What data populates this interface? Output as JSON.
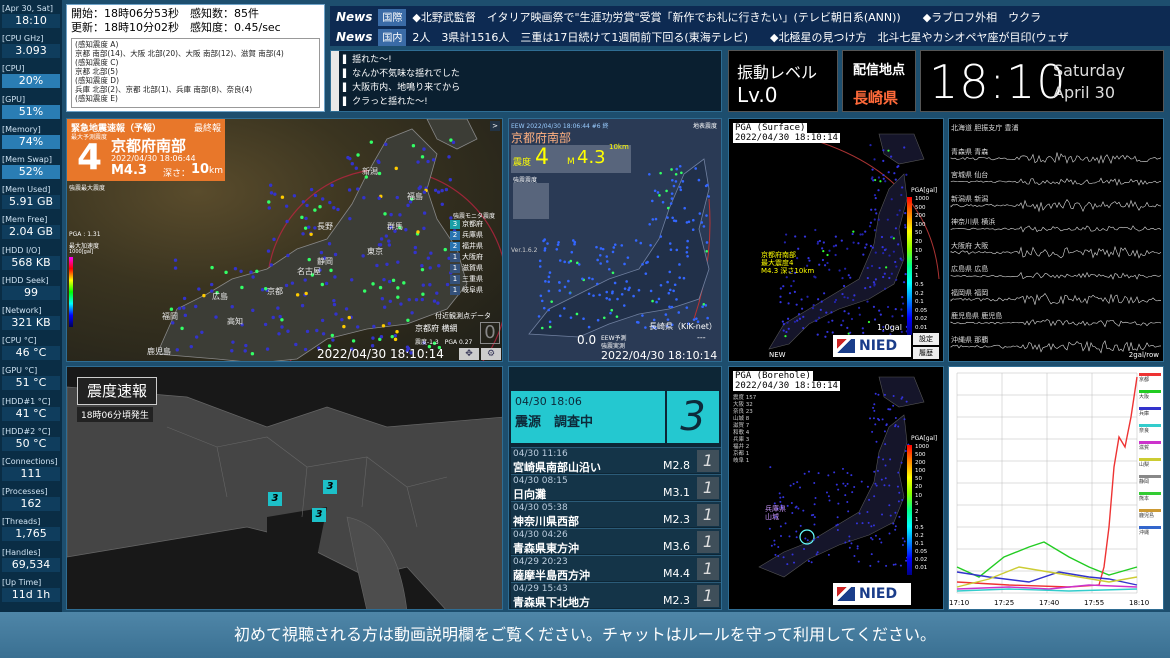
{
  "sidebar": {
    "items": [
      {
        "label": "[Apr 30, Sat]",
        "value": "18:10"
      },
      {
        "label": "[CPU GHz]",
        "value": "3.093"
      },
      {
        "label": "[CPU]",
        "value": "20%"
      },
      {
        "label": "[GPU]",
        "value": "51%"
      },
      {
        "label": "[Memory]",
        "value": "74%"
      },
      {
        "label": "[Mem Swap]",
        "value": "52%"
      },
      {
        "label": "[Mem Used]",
        "value": "5.91 GB"
      },
      {
        "label": "[Mem Free]",
        "value": "2.04 GB"
      },
      {
        "label": "[HDD I/O]",
        "value": "568 KB"
      },
      {
        "label": "[HDD Seek]",
        "value": "99"
      },
      {
        "label": "[Network]",
        "value": "321 KB"
      },
      {
        "label": "[CPU °C]",
        "value": "46 °C"
      },
      {
        "label": "[GPU °C]",
        "value": "51 °C"
      },
      {
        "label": "[HDD#1 °C]",
        "value": "41 °C"
      },
      {
        "label": "[HDD#2 °C]",
        "value": "50 °C"
      },
      {
        "label": "[Connections]",
        "value": "111"
      },
      {
        "label": "[Processes]",
        "value": "162"
      },
      {
        "label": "[Threads]",
        "value": "1,765"
      },
      {
        "label": "[Handles]",
        "value": "69,534"
      },
      {
        "label": "[Up Time]",
        "value": "11d 1h"
      }
    ]
  },
  "info_box": {
    "line1": "開始：18時06分53秒　感知数：85件",
    "line2": "更新：18時10分02秒　感知度：0.45/sec",
    "details": [
      "(感知震度 A)",
      "京都 南部(14)、大阪 北部(20)、大阪 南部(12)、滋賀 南部(4)",
      "(感知震度 C)",
      "京都 北部(5)",
      "(感知震度 D)",
      "兵庫 北部(2)、京都 北部(1)、兵庫 南部(8)、奈良(4)",
      "(感知震度 E)"
    ]
  },
  "news": [
    {
      "tag": "News",
      "sub": "国際",
      "text": "◆北野武監督　イタリア映画祭で\"生涯功労賞\"受賞「新作でお礼に行きたい」(テレビ朝日系(ANN))　　◆ラブロフ外相　ウクラ"
    },
    {
      "tag": "News",
      "sub": "国内",
      "text": "2人　3県計1516人　三重は17日続けて1週間前下回る(東海テレビ)　　◆北極星の見つけ方　北斗七星やカシオペヤ座が目印(ウェザ"
    }
  ],
  "chat": [
    "揺れた～!",
    "なんか不気味な揺れでした",
    "大阪市内、地鳴り来てから",
    "クラっと揺れた～!"
  ],
  "shindo_level": {
    "label": "振動レベル",
    "value": "Lv.0"
  },
  "broadcast": {
    "label": "配信地点",
    "value": "長崎県"
  },
  "clock": {
    "time": "18:10",
    "day": "Saturday",
    "date": "April 30"
  },
  "eew": {
    "header": "緊急地震速報（予報）",
    "final": "最終報",
    "sub": "最大予測震度",
    "intensity": "4",
    "region": "京都府南部",
    "datetime": "2022/04/30 18:06:44",
    "magnitude": "M4.3",
    "depth_label": "深さ：",
    "depth": "10",
    "depth_unit": "km",
    "legend_title": "強震モニタ震度",
    "regions": [
      {
        "i": "3",
        "n": "京都府"
      },
      {
        "i": "2",
        "n": "兵庫県"
      },
      {
        "i": "2",
        "n": "福井県"
      },
      {
        "i": "1",
        "n": "大阪府"
      },
      {
        "i": "1",
        "n": "滋賀県"
      },
      {
        "i": "1",
        "n": "三重県"
      },
      {
        "i": "1",
        "n": "岐阜県"
      }
    ],
    "left_small": [
      "強震最大震度",
      "PGA : 1.31",
      "最大加速度"
    ],
    "scale_unit": "1000[gal]",
    "station_label": "付近観測点データ",
    "station": "京都府 横網",
    "station_val": "0",
    "station_vals": "震度-1.3　PGA 0.27",
    "timestamp": "2022/04/30 18:10:14",
    "places": [
      "新潟",
      "福島",
      "長野",
      "群馬",
      "東京",
      "静岡",
      "名古屋",
      "京都",
      "広島",
      "福岡",
      "高知",
      "鹿児島"
    ]
  },
  "kmoni": {
    "header": "EEW  2022/04/30 18:06:44 #6 終",
    "region": "京都府南部",
    "intensity_label": "震度",
    "intensity": "4",
    "magnitude": "M",
    "mag_val": "4.3",
    "depth": "10km",
    "sub": "強震震度",
    "version": "Ver.1.6.2",
    "map_label": "地表震度",
    "bottom_val": "0.0",
    "bottom_l1": "EEW予測",
    "bottom_l2": "強震実測",
    "station": "長崎県（KiK-net）",
    "station_val": "---",
    "timestamp": "2022/04/30 18:10:14"
  },
  "pga_surface": {
    "title": "PGA (Surface)",
    "time": "2022/04/30 18:10:14",
    "scale_title": "PGA[gal]",
    "scale": [
      "1000",
      "500",
      "200",
      "100",
      "50",
      "20",
      "10",
      "5",
      "2",
      "1",
      "0.5",
      "0.2",
      "0.1",
      "0.05",
      "0.02",
      "0.01"
    ],
    "annot": "京都府南部\n最大震度4\nM4.3 深さ10km",
    "value": "1.0gal",
    "badge": "NEW",
    "logo": "NIED",
    "btns": [
      "設定",
      "履歴"
    ]
  },
  "waveforms": {
    "stations": [
      "北海道 胆振支庁 豊浦",
      "青森県 青森",
      "宮城県 仙台",
      "新潟県 新潟",
      "神奈川県 横浜",
      "大阪府 大阪",
      "広島県 広島",
      "福岡県 福岡",
      "鹿児島県 鹿児島",
      "沖縄県 那覇"
    ],
    "unit": "2gal/row"
  },
  "quake_map": {
    "title": "震度速報",
    "subtitle": "18時06分頃発生",
    "markers": [
      "3",
      "3",
      "3"
    ]
  },
  "quake_list": {
    "latest": {
      "datetime": "04/30 18:06",
      "epicenter": "震源　調査中",
      "intensity": "3"
    },
    "items": [
      {
        "datetime": "04/30 11:16",
        "place": "宮崎県南部山沿い",
        "mag": "M2.8",
        "intensity": "1"
      },
      {
        "datetime": "04/30 08:15",
        "place": "日向灘",
        "mag": "M3.1",
        "intensity": "1"
      },
      {
        "datetime": "04/30 05:38",
        "place": "神奈川県西部",
        "mag": "M2.3",
        "intensity": "1"
      },
      {
        "datetime": "04/30 04:26",
        "place": "青森県東方沖",
        "mag": "M3.6",
        "intensity": "1"
      },
      {
        "datetime": "04/29 20:23",
        "place": "薩摩半島西方沖",
        "mag": "M4.4",
        "intensity": "1"
      },
      {
        "datetime": "04/29 15:43",
        "place": "青森県下北地方",
        "mag": "M2.3",
        "intensity": "1"
      }
    ]
  },
  "pga_borehole": {
    "title": "PGA (Borehole)",
    "time": "2022/04/30 18:10:14",
    "scale_title": "PGA[gal]",
    "counts": [
      "震度 157",
      "大阪 32",
      "奈良 23",
      "山城 8",
      "滋賀 7",
      "和歌 4",
      "兵庫 3",
      "福井 2",
      "京都 1",
      "岐阜 1"
    ],
    "annot": "兵庫県\n山城",
    "logo": "NIED"
  },
  "graph": {
    "x_labels": [
      "17:10",
      "17:25",
      "17:40",
      "17:55",
      "18:10"
    ],
    "legend": [
      "京都",
      "大阪",
      "兵庫",
      "奈良",
      "滋賀",
      "山梨",
      "静岡",
      "熊本",
      "鹿児島",
      "沖縄"
    ]
  },
  "footer": "初めて視聴される方は動画説明欄をご覧ください。チャットはルールを守って利用してください。"
}
